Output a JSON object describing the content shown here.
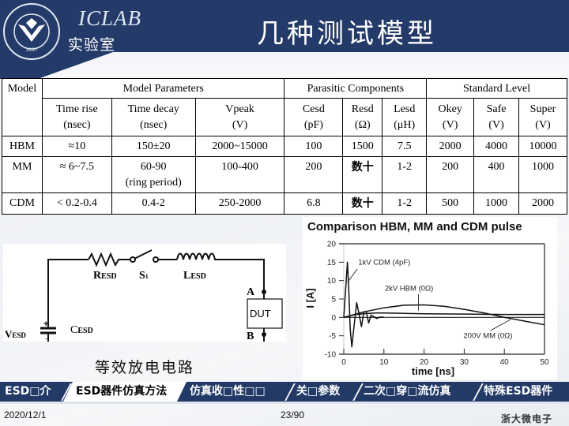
{
  "header": {
    "brand_en": "ICLAB",
    "brand_cn": "实验室",
    "logo_icon": "zhejiang-university-logo-icon",
    "title": "几种测试模型"
  },
  "table": {
    "group_headers": {
      "model": "Model",
      "model_parameters": "Model Parameters",
      "parasitic_components": "Parasitic Components",
      "standard_level": "Standard Level"
    },
    "columns": [
      {
        "name": "Time rise",
        "unit": "(nsec)"
      },
      {
        "name": "Time decay",
        "unit": "(nsec)"
      },
      {
        "name": "Vpeak",
        "unit": "(V)"
      },
      {
        "name": "Cesd",
        "unit": "(pF)"
      },
      {
        "name": "Resd",
        "unit": "(Ω)"
      },
      {
        "name": "Lesd",
        "unit": "(μH)"
      },
      {
        "name": "Okey",
        "unit": "(V)"
      },
      {
        "name": "Safe",
        "unit": "(V)"
      },
      {
        "name": "Super",
        "unit": "(V)"
      }
    ],
    "rows": [
      {
        "model": "HBM",
        "time_rise": "≈10",
        "time_decay": "150±20",
        "time_decay_note": "",
        "vpeak": "2000~15000",
        "cesd": "100",
        "resd": "1500",
        "lesd": "7.5",
        "okey": "2000",
        "safe": "4000",
        "super": "10000"
      },
      {
        "model": "MM",
        "time_rise": "≈ 6~7.5",
        "time_decay": "60-90",
        "time_decay_note": "(ring period)",
        "vpeak": "100-400",
        "cesd": "200",
        "resd": "数十",
        "lesd": "1-2",
        "okey": "200",
        "safe": "400",
        "super": "1000"
      },
      {
        "model": "CDM",
        "time_rise": "< 0.2-0.4",
        "time_decay": "0.4-2",
        "time_decay_note": "",
        "vpeak": "250-2000",
        "cesd": "6.8",
        "resd": "数十",
        "lesd": "1-2",
        "okey": "500",
        "safe": "1000",
        "super": "2000"
      }
    ]
  },
  "circuit": {
    "caption": "等效放电电路",
    "labels": {
      "r": "R",
      "r_sub": "ESD",
      "s": "S",
      "s_sub": "1",
      "l": "L",
      "l_sub": "ESD",
      "c": "C",
      "c_sub": "ESD",
      "v": "V",
      "v_sub": "ESD",
      "a": "A",
      "b": "B",
      "dut": "DUT",
      "plus": "+",
      "minus": "-"
    }
  },
  "chart_data": {
    "type": "line",
    "title": "Comparison HBM, MM and CDM pulse",
    "xlabel": "time [ns]",
    "ylabel": "I [A]",
    "xlim": [
      0,
      50
    ],
    "ylim": [
      -10,
      20
    ],
    "xticks": [
      0,
      10,
      20,
      30,
      40,
      50
    ],
    "yticks": [
      20,
      15,
      10,
      5,
      0,
      -5,
      -10
    ],
    "grid": false,
    "series": [
      {
        "name": "1kV CDM (4pF)",
        "x": [
          0,
          0.5,
          0.9,
          1.2,
          1.6,
          2.0,
          2.6,
          3.2,
          3.8,
          4.4,
          5.0,
          5.6,
          6.2,
          6.8,
          7.5,
          8.2,
          9.0,
          10
        ],
        "y": [
          0,
          8,
          15,
          9,
          -3,
          -8,
          -2,
          4,
          1,
          -2.5,
          1.5,
          1.5,
          -1.5,
          0.6,
          0.2,
          -0.3,
          0.1,
          0
        ]
      },
      {
        "name": "2kV HBM (0Ω)",
        "x": [
          0,
          5,
          10,
          15,
          20,
          25,
          30,
          35,
          40,
          45,
          50
        ],
        "y": [
          0,
          1.5,
          2.6,
          3.3,
          3.4,
          3.0,
          2.2,
          1.2,
          0.0,
          -1.0,
          -2.0
        ]
      },
      {
        "name": "200V MM (0Ω)",
        "x": [
          0,
          3,
          6,
          8,
          10,
          15,
          20,
          30,
          40,
          50
        ],
        "y": [
          0,
          0.8,
          1.1,
          1.2,
          1.2,
          1.1,
          1.0,
          0.9,
          0.8,
          0.8
        ]
      }
    ],
    "annotations": [
      "1kV CDM (4pF)",
      "2kV HBM (0Ω)",
      "200V MM (0Ω)"
    ]
  },
  "nav": {
    "items": [
      {
        "label": "ESD□介",
        "active": false
      },
      {
        "label": "ESD器件仿真方法",
        "active": true
      },
      {
        "label": "仿真收□性□□",
        "active": false
      },
      {
        "label": "关□参数",
        "active": false
      },
      {
        "label": "二次□穿□流仿真",
        "active": false
      },
      {
        "label": "特殊ESD器件",
        "active": false
      }
    ]
  },
  "footer": {
    "date": "2020/12/1",
    "page": "23/90",
    "org": "浙大微电子"
  }
}
